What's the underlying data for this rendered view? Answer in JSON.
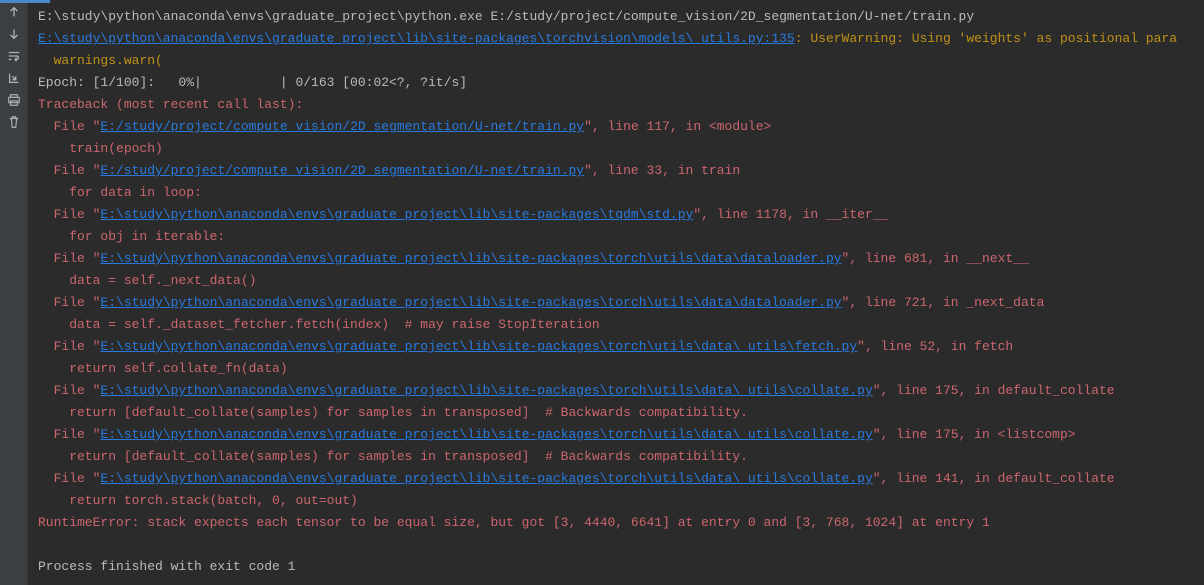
{
  "gutter": {
    "icons": [
      "arrow-up",
      "arrow-down",
      "wrap",
      "scroll-to-end",
      "print",
      "trash"
    ]
  },
  "lines": [
    {
      "segs": [
        {
          "cls": "plain",
          "t": "E:\\study\\python\\anaconda\\envs\\graduate_project\\python.exe E:/study/project/compute_vision/2D_segmentation/U-net/train.py"
        }
      ]
    },
    {
      "segs": [
        {
          "cls": "link",
          "t": "E:\\study\\python\\anaconda\\envs\\graduate_project\\lib\\site-packages\\torchvision\\models\\_utils.py:135"
        },
        {
          "cls": "warn",
          "t": ": UserWarning: Using 'weights' as positional para"
        }
      ]
    },
    {
      "segs": [
        {
          "cls": "warn",
          "t": "  warnings.warn("
        }
      ]
    },
    {
      "segs": [
        {
          "cls": "plain",
          "t": "Epoch: [1/100]:   0%|          | 0/163 [00:02<?, ?it/s]"
        }
      ]
    },
    {
      "segs": [
        {
          "cls": "err",
          "t": "Traceback (most recent call last):"
        }
      ]
    },
    {
      "segs": [
        {
          "cls": "err",
          "t": "  File \""
        },
        {
          "cls": "link",
          "t": "E:/study/project/compute_vision/2D_segmentation/U-net/train.py"
        },
        {
          "cls": "err",
          "t": "\", line 117, in <module>"
        }
      ]
    },
    {
      "segs": [
        {
          "cls": "err",
          "t": "    train(epoch)"
        }
      ]
    },
    {
      "segs": [
        {
          "cls": "err",
          "t": "  File \""
        },
        {
          "cls": "link",
          "t": "E:/study/project/compute_vision/2D_segmentation/U-net/train.py"
        },
        {
          "cls": "err",
          "t": "\", line 33, in train"
        }
      ]
    },
    {
      "segs": [
        {
          "cls": "err",
          "t": "    for data in loop:"
        }
      ]
    },
    {
      "segs": [
        {
          "cls": "err",
          "t": "  File \""
        },
        {
          "cls": "link",
          "t": "E:\\study\\python\\anaconda\\envs\\graduate_project\\lib\\site-packages\\tqdm\\std.py"
        },
        {
          "cls": "err",
          "t": "\", line 1178, in __iter__"
        }
      ]
    },
    {
      "segs": [
        {
          "cls": "err",
          "t": "    for obj in iterable:"
        }
      ]
    },
    {
      "segs": [
        {
          "cls": "err",
          "t": "  File \""
        },
        {
          "cls": "link",
          "t": "E:\\study\\python\\anaconda\\envs\\graduate_project\\lib\\site-packages\\torch\\utils\\data\\dataloader.py"
        },
        {
          "cls": "err",
          "t": "\", line 681, in __next__"
        }
      ]
    },
    {
      "segs": [
        {
          "cls": "err",
          "t": "    data = self._next_data()"
        }
      ]
    },
    {
      "segs": [
        {
          "cls": "err",
          "t": "  File \""
        },
        {
          "cls": "link",
          "t": "E:\\study\\python\\anaconda\\envs\\graduate_project\\lib\\site-packages\\torch\\utils\\data\\dataloader.py"
        },
        {
          "cls": "err",
          "t": "\", line 721, in _next_data"
        }
      ]
    },
    {
      "segs": [
        {
          "cls": "err",
          "t": "    data = self._dataset_fetcher.fetch(index)  # may raise StopIteration"
        }
      ]
    },
    {
      "segs": [
        {
          "cls": "err",
          "t": "  File \""
        },
        {
          "cls": "link",
          "t": "E:\\study\\python\\anaconda\\envs\\graduate_project\\lib\\site-packages\\torch\\utils\\data\\_utils\\fetch.py"
        },
        {
          "cls": "err",
          "t": "\", line 52, in fetch"
        }
      ]
    },
    {
      "segs": [
        {
          "cls": "err",
          "t": "    return self.collate_fn(data)"
        }
      ]
    },
    {
      "segs": [
        {
          "cls": "err",
          "t": "  File \""
        },
        {
          "cls": "link",
          "t": "E:\\study\\python\\anaconda\\envs\\graduate_project\\lib\\site-packages\\torch\\utils\\data\\_utils\\collate.py"
        },
        {
          "cls": "err",
          "t": "\", line 175, in default_collate"
        }
      ]
    },
    {
      "segs": [
        {
          "cls": "err",
          "t": "    return [default_collate(samples) for samples in transposed]  # Backwards compatibility."
        }
      ]
    },
    {
      "segs": [
        {
          "cls": "err",
          "t": "  File \""
        },
        {
          "cls": "link",
          "t": "E:\\study\\python\\anaconda\\envs\\graduate_project\\lib\\site-packages\\torch\\utils\\data\\_utils\\collate.py"
        },
        {
          "cls": "err",
          "t": "\", line 175, in <listcomp>"
        }
      ]
    },
    {
      "segs": [
        {
          "cls": "err",
          "t": "    return [default_collate(samples) for samples in transposed]  # Backwards compatibility."
        }
      ]
    },
    {
      "segs": [
        {
          "cls": "err",
          "t": "  File \""
        },
        {
          "cls": "link",
          "t": "E:\\study\\python\\anaconda\\envs\\graduate_project\\lib\\site-packages\\torch\\utils\\data\\_utils\\collate.py"
        },
        {
          "cls": "err",
          "t": "\", line 141, in default_collate"
        }
      ]
    },
    {
      "segs": [
        {
          "cls": "err",
          "t": "    return torch.stack(batch, 0, out=out)"
        }
      ]
    },
    {
      "segs": [
        {
          "cls": "err",
          "t": "RuntimeError: stack expects each tensor to be equal size, but got [3, 4440, 6641] at entry 0 and [3, 768, 1024] at entry 1"
        }
      ]
    },
    {
      "segs": [
        {
          "cls": "plain",
          "t": ""
        }
      ]
    },
    {
      "segs": [
        {
          "cls": "plain",
          "t": "Process finished with exit code 1"
        }
      ]
    }
  ]
}
